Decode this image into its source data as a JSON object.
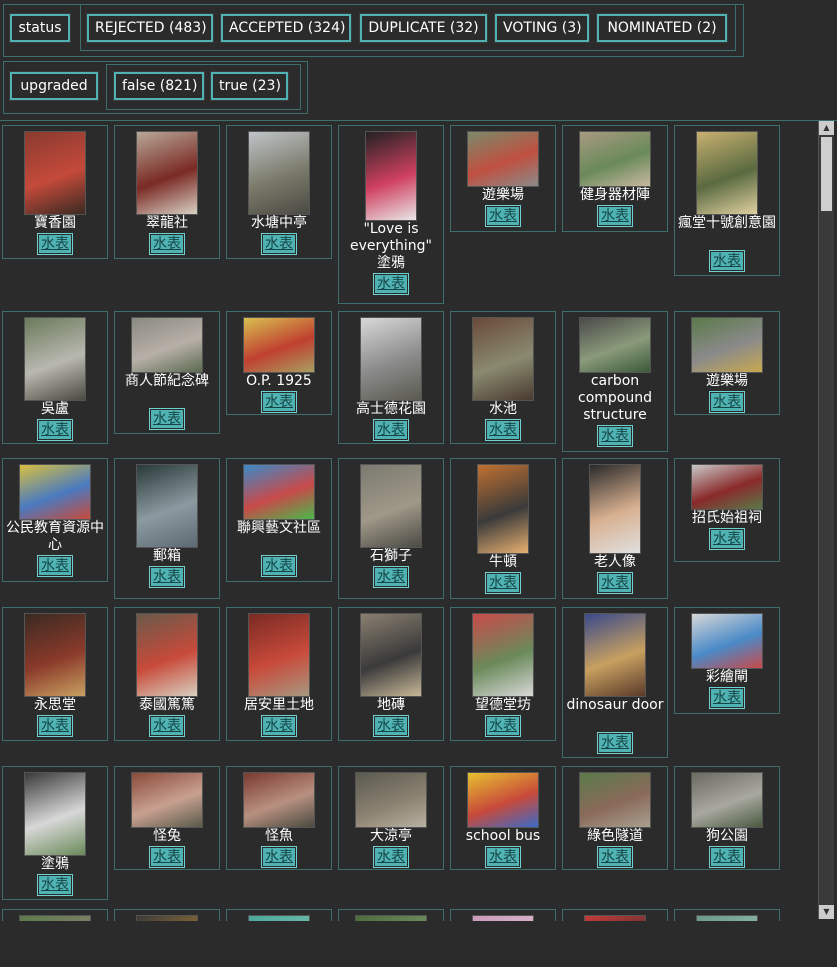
{
  "filters": {
    "status": {
      "label": "status",
      "options": [
        {
          "label": "REJECTED (483)"
        },
        {
          "label": "ACCEPTED (324)"
        },
        {
          "label": "DUPLICATE (32)"
        },
        {
          "label": "VOTING (3)"
        },
        {
          "label": "NOMINATED (2)"
        }
      ]
    },
    "upgraded": {
      "label": "upgraded",
      "options": [
        {
          "label": "false (821)"
        },
        {
          "label": "true (23)"
        }
      ]
    }
  },
  "link_label": "水表",
  "items": [
    {
      "label": "寶香園",
      "colors": [
        "#8a3a30",
        "#c44a3a",
        "#3a2a22"
      ]
    },
    {
      "label": "翠龍社",
      "colors": [
        "#b8a898",
        "#7a2a24",
        "#d8d0c4"
      ]
    },
    {
      "label": "水塘中亭",
      "colors": [
        "#c0c4c8",
        "#7a7a6a",
        "#4a4a44"
      ]
    },
    {
      "label": "\"Love is everything\" 塗鴉",
      "colors": [
        "#222222",
        "#d04060",
        "#e8e8e8"
      ]
    },
    {
      "label": "遊樂場",
      "colors": [
        "#7a8a6a",
        "#c05040",
        "#8a8a8a"
      ]
    },
    {
      "label": "健身器材陣",
      "colors": [
        "#a89a80",
        "#6a8a5a",
        "#c8b8a0"
      ]
    },
    {
      "label": "瘋堂十號創意園",
      "colors": [
        "#c8b070",
        "#5a6a40",
        "#e0d0a0"
      ]
    },
    {
      "label": "吳盧",
      "colors": [
        "#6a7a5a",
        "#b8b8b0",
        "#4a4a40"
      ]
    },
    {
      "label": "商人節紀念碑",
      "colors": [
        "#8a8a80",
        "#b8b0a8",
        "#5a6a50"
      ]
    },
    {
      "label": "O.P. 1925",
      "colors": [
        "#d8c050",
        "#c04030",
        "#a8a060"
      ]
    },
    {
      "label": "高士德花園",
      "colors": [
        "#d8d8d8",
        "#8a8a8a",
        "#5a5a50"
      ]
    },
    {
      "label": "水池",
      "colors": [
        "#6a4a3a",
        "#8a8a70",
        "#4a3a30"
      ]
    },
    {
      "label": "carbon compound structure",
      "colors": [
        "#4a4a4a",
        "#8a9a7a",
        "#3a5a3a"
      ]
    },
    {
      "label": "遊樂場",
      "colors": [
        "#5a7a4a",
        "#8a8a8a",
        "#c8a850"
      ]
    },
    {
      "label": "公民教育資源中心",
      "colors": [
        "#d8c040",
        "#4a7ac0",
        "#c84a3a"
      ]
    },
    {
      "label": "郵箱",
      "colors": [
        "#2a3a3a",
        "#8a9aa0",
        "#5a6a70"
      ]
    },
    {
      "label": "聯興藝文社區",
      "colors": [
        "#3a8ac8",
        "#c84a4a",
        "#4ab84a"
      ]
    },
    {
      "label": "石獅子",
      "colors": [
        "#7a7a70",
        "#a09888",
        "#4a4a44"
      ]
    },
    {
      "label": "牛頓",
      "colors": [
        "#c07030",
        "#3a3a3a",
        "#e8b070"
      ]
    },
    {
      "label": "老人像",
      "colors": [
        "#2a2a2a",
        "#d8b090",
        "#e0e0e0"
      ]
    },
    {
      "label": "招氏始祖祠",
      "colors": [
        "#c8c8c8",
        "#8a2a2a",
        "#5a7a4a"
      ]
    },
    {
      "label": "永思堂",
      "colors": [
        "#3a2a22",
        "#8a3a2a",
        "#c8a060"
      ]
    },
    {
      "label": "泰國篤篤",
      "colors": [
        "#6a5a4a",
        "#c84a3a",
        "#d8d0c0"
      ]
    },
    {
      "label": "居安里土地",
      "colors": [
        "#7a2a24",
        "#c84a3a",
        "#a89880"
      ]
    },
    {
      "label": "地磚",
      "colors": [
        "#8a8070",
        "#3a3a3a",
        "#c8b898"
      ]
    },
    {
      "label": "望德堂坊",
      "colors": [
        "#c84a4a",
        "#6a8a5a",
        "#d8d8d8"
      ]
    },
    {
      "label": "dinosaur door",
      "colors": [
        "#3a4a8a",
        "#c8a060",
        "#5a3a2a"
      ]
    },
    {
      "label": "彩繪閘",
      "colors": [
        "#d8d8d8",
        "#4a8ac8",
        "#c84a4a"
      ]
    },
    {
      "label": "塗鴉",
      "colors": [
        "#3a3a3a",
        "#d8d8d8",
        "#6a8a5a"
      ]
    },
    {
      "label": "怪兔",
      "colors": [
        "#8a4a3a",
        "#c8a090",
        "#5a5a4a"
      ]
    },
    {
      "label": "怪魚",
      "colors": [
        "#7a3a30",
        "#b89080",
        "#4a4a40"
      ]
    },
    {
      "label": "大涼亭",
      "colors": [
        "#5a5a50",
        "#8a8070",
        "#b8b0a0"
      ]
    },
    {
      "label": "school bus",
      "colors": [
        "#e8c030",
        "#c84a3a",
        "#3a6ac8"
      ]
    },
    {
      "label": "綠色隧道",
      "colors": [
        "#5a7a4a",
        "#8a6a5a",
        "#a8a090"
      ]
    },
    {
      "label": "狗公園",
      "colors": [
        "#6a6a60",
        "#a8a8a0",
        "#4a5a40"
      ]
    },
    {
      "label": "",
      "colors": [
        "#5a7a4a",
        "#8a8070",
        "#4a4a40"
      ]
    },
    {
      "label": "",
      "colors": [
        "#3a3a3a",
        "#c89030",
        "#5a5a50"
      ]
    },
    {
      "label": "",
      "colors": [
        "#4aa89a",
        "#8ac8b8",
        "#5a8a7a"
      ]
    },
    {
      "label": "",
      "colors": [
        "#4a6a3a",
        "#7a9a6a",
        "#c8c8c8"
      ]
    },
    {
      "label": "",
      "colors": [
        "#c89ab8",
        "#e8c8d8",
        "#8ab8c8"
      ]
    },
    {
      "label": "",
      "colors": [
        "#c83a3a",
        "#2a2a2a",
        "#e8e8e8"
      ]
    },
    {
      "label": "",
      "colors": [
        "#6a9a8a",
        "#a8c8b8",
        "#4a6a5a"
      ]
    }
  ]
}
